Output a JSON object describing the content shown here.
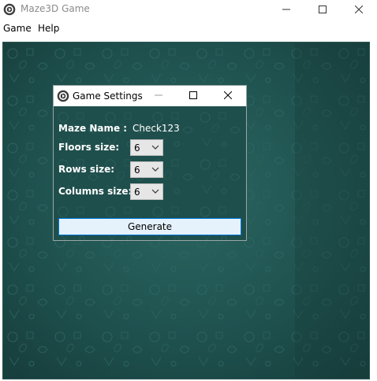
{
  "window": {
    "title": "Maze3D Game",
    "icon": "maze3d-app-icon"
  },
  "menu": {
    "items": [
      "Game",
      "Help"
    ]
  },
  "dialog": {
    "title": "Game Settings",
    "fields": {
      "maze_name": {
        "label": "Maze Name :",
        "value": "Check123"
      },
      "floors": {
        "label": "Floors size:",
        "value": "6"
      },
      "rows": {
        "label": "Rows size:",
        "value": "6"
      },
      "columns": {
        "label": "Columns size:",
        "value": "6"
      }
    },
    "generate_label": "Generate"
  },
  "colors": {
    "background_teal": "#1d4b49",
    "button_border": "#0078d7",
    "button_fill": "#e5f1fb"
  }
}
